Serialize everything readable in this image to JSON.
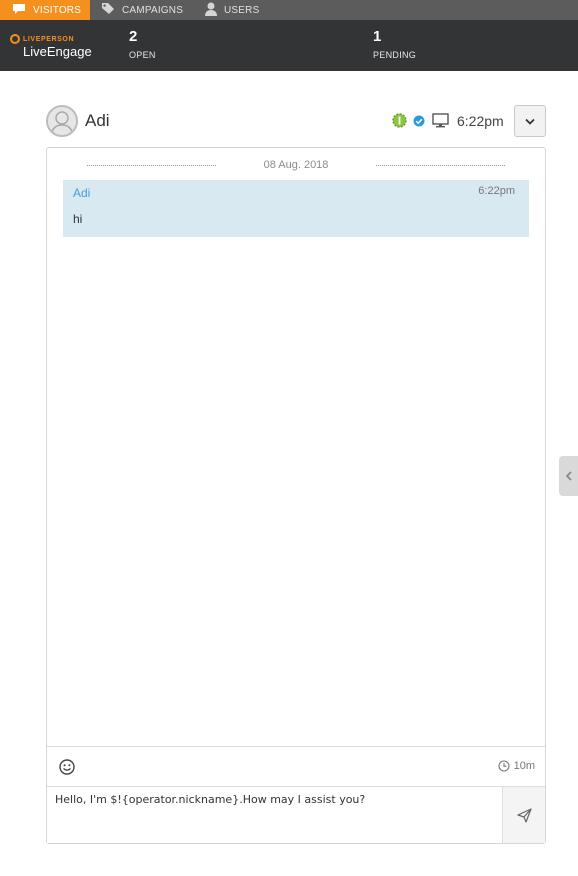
{
  "nav": {
    "tabs": [
      {
        "label": "VISITORS",
        "icon": "chat-bubble-icon",
        "active": true
      },
      {
        "label": "CAMPAIGNS",
        "icon": "tag-icon",
        "active": false
      },
      {
        "label": "USERS",
        "icon": "user-icon",
        "active": false
      }
    ]
  },
  "header": {
    "logo_top": "LIVEPERSON",
    "logo_bottom": "LiveEngage",
    "open": {
      "count": "2",
      "label": "OPEN"
    },
    "pending": {
      "count": "1",
      "label": "PENDING"
    }
  },
  "visitor": {
    "name": "Adi",
    "time": "6:22pm",
    "icons": [
      "engagement-status-icon",
      "verified-check-icon",
      "desktop-icon"
    ]
  },
  "chat": {
    "date": "08 Aug. 2018",
    "messages": [
      {
        "sender": "Adi",
        "time": "6:22pm",
        "text": "hi"
      }
    ],
    "timer": "10m",
    "composer_text": "Hello, I'm $!{operator.nickname}.How may I assist you?"
  },
  "colors": {
    "accent": "#f5901e",
    "header_bg": "#333436",
    "nav_bg": "#5c5c5c",
    "message_bg": "#d8e9f2",
    "sender_name": "#4a9fd0"
  }
}
